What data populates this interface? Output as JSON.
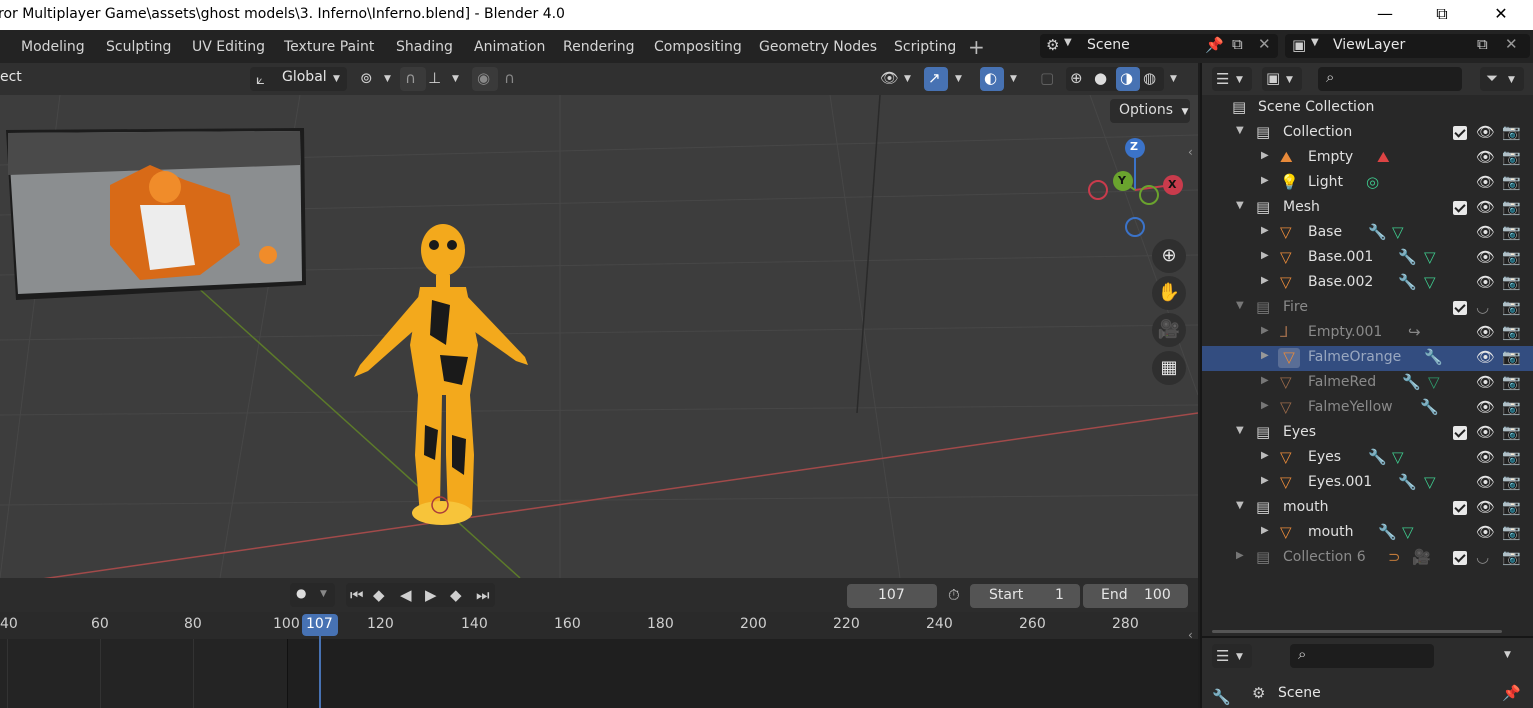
{
  "window": {
    "title": "ror Multiplayer Game\\assets\\ghost models\\3. Inferno\\Inferno.blend] - Blender 4.0",
    "minimize": "—",
    "maximize": "⧉",
    "close": "✕"
  },
  "workspaces": [
    "Modeling",
    "Sculpting",
    "UV Editing",
    "Texture Paint",
    "Shading",
    "Animation",
    "Rendering",
    "Compositing",
    "Geometry Nodes",
    "Scripting"
  ],
  "workspace_add": "+",
  "scene": {
    "name": "Scene"
  },
  "view_layer": {
    "name": "ViewLayer"
  },
  "viewport_header": {
    "mode_fragment": "ect",
    "orientation": "Global"
  },
  "viewport": {
    "options_label": "Options",
    "gizmo": {
      "z": "Z",
      "y": "Y",
      "x": "X"
    },
    "accent_selected": "#4772b3"
  },
  "timeline": {
    "current_frame": "107",
    "start_label": "Start",
    "start_value": "1",
    "end_label": "End",
    "end_value": "100",
    "ticks": [
      "40",
      "60",
      "80",
      "100",
      "107",
      "120",
      "140",
      "160",
      "180",
      "200",
      "220",
      "240",
      "260",
      "280"
    ]
  },
  "outliner": {
    "search_placeholder": "",
    "rows": [
      {
        "label": "Scene Collection",
        "kind": "scene-collection",
        "indent": 0
      },
      {
        "label": "Collection",
        "kind": "collection",
        "indent": 1,
        "check": true
      },
      {
        "label": "Empty",
        "kind": "empty",
        "indent": 2
      },
      {
        "label": "Light",
        "kind": "light",
        "indent": 2
      },
      {
        "label": "Mesh",
        "kind": "collection",
        "indent": 1,
        "check": true
      },
      {
        "label": "Base",
        "kind": "mesh",
        "indent": 2
      },
      {
        "label": "Base.001",
        "kind": "mesh",
        "indent": 2
      },
      {
        "label": "Base.002",
        "kind": "mesh",
        "indent": 2
      },
      {
        "label": "Fire",
        "kind": "collection",
        "indent": 1,
        "check": true,
        "disabled": true
      },
      {
        "label": "Empty.001",
        "kind": "empty",
        "indent": 2,
        "disabled": true
      },
      {
        "label": "FalmeOrange",
        "kind": "mesh",
        "indent": 2,
        "disabled": true,
        "selected": true
      },
      {
        "label": "FalmeRed",
        "kind": "mesh",
        "indent": 2,
        "disabled": true
      },
      {
        "label": "FalmeYellow",
        "kind": "mesh",
        "indent": 2,
        "disabled": true
      },
      {
        "label": "Eyes",
        "kind": "collection",
        "indent": 1,
        "check": true
      },
      {
        "label": "Eyes",
        "kind": "mesh",
        "indent": 2
      },
      {
        "label": "Eyes.001",
        "kind": "mesh",
        "indent": 2
      },
      {
        "label": "mouth",
        "kind": "collection",
        "indent": 1,
        "check": true
      },
      {
        "label": "mouth",
        "kind": "mesh",
        "indent": 2
      },
      {
        "label": "Collection 6",
        "kind": "collection",
        "indent": 1,
        "check": true,
        "disabled": true
      }
    ]
  },
  "properties": {
    "context": "Scene"
  }
}
